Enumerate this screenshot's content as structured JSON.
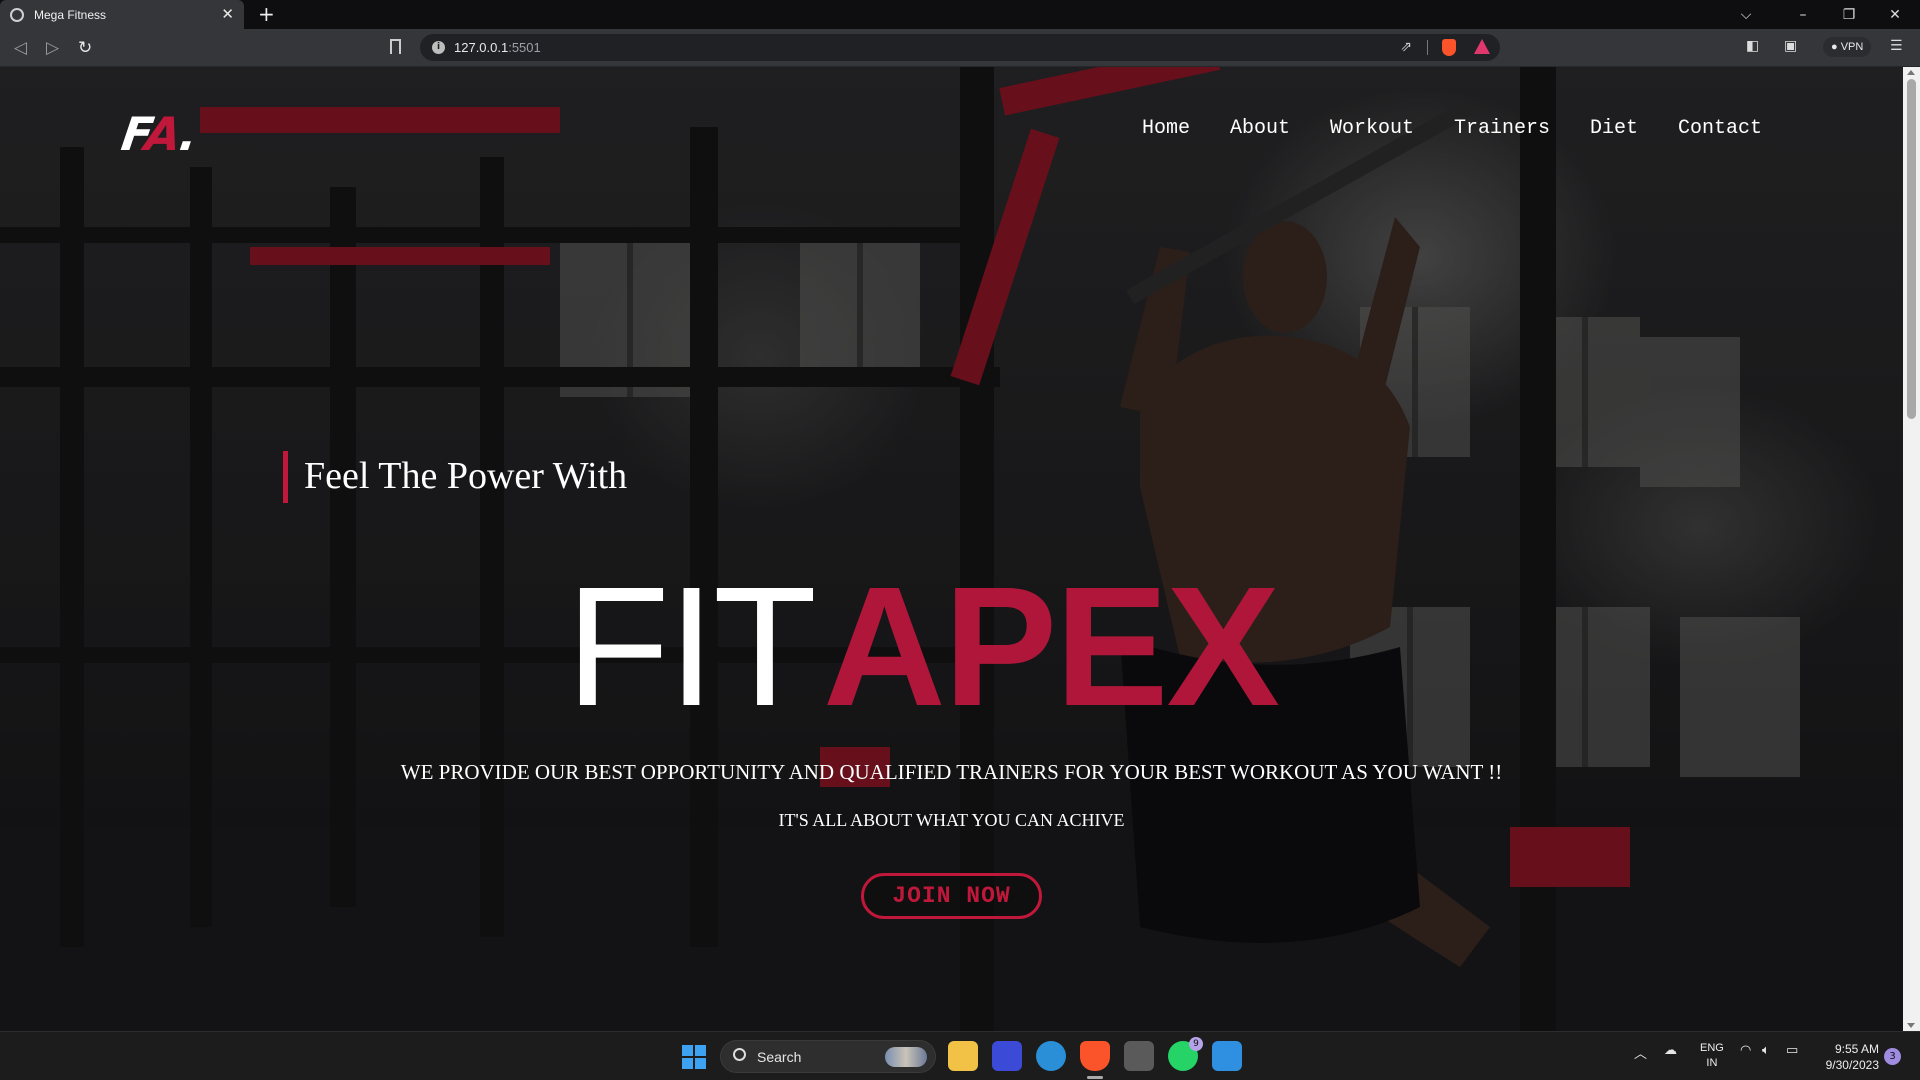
{
  "browser": {
    "tab_title": "Mega Fitness",
    "new_tab_label": "+",
    "url_host": "127.0.0.1",
    "url_port": ":5501",
    "vpn_label": "VPN"
  },
  "site": {
    "logo_f": "F",
    "logo_a": "A",
    "logo_dot": ".",
    "nav": [
      "Home",
      "About",
      "Workout",
      "Trainers",
      "Diet",
      "Contact"
    ],
    "tagline": "Feel The Power With",
    "brand_fit": "FIT",
    "brand_apex": "APEX",
    "subtitle": "WE PROVIDE OUR BEST OPPORTUNITY AND QUALIFIED TRAINERS FOR YOUR BEST WORKOUT AS YOU WANT !!",
    "subtitle2": "IT'S ALL ABOUT WHAT YOU CAN ACHIVE",
    "cta": "JOIN NOW",
    "accent_color": "#c0183a"
  },
  "taskbar": {
    "search_label": "Search",
    "whatsapp_badge": "9",
    "lang_line1": "ENG",
    "lang_line2": "IN",
    "time": "9:55 AM",
    "date": "9/30/2023",
    "notification_count": "3"
  }
}
